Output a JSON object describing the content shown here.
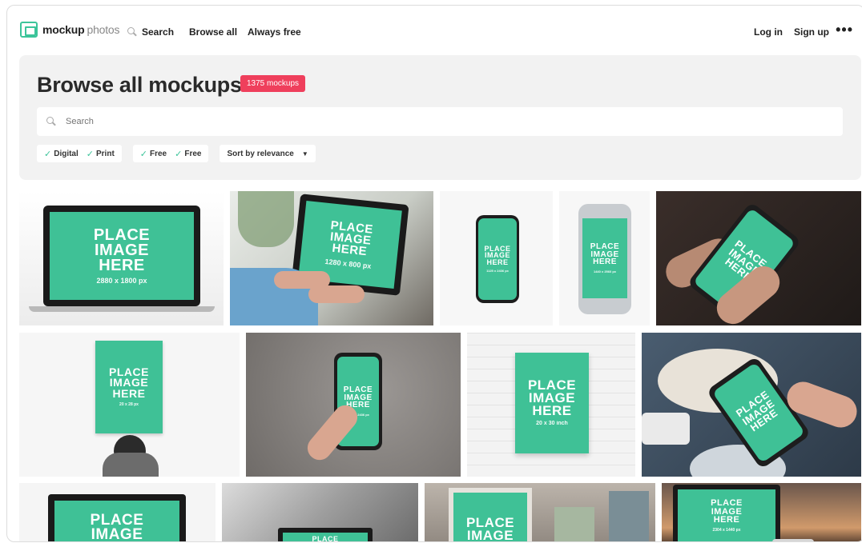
{
  "nav": {
    "logo_strong": "mockup",
    "logo_light": "photos",
    "search_label": "Search",
    "browse_all": "Browse all",
    "always_free": "Always free",
    "log_in": "Log in",
    "sign_up": "Sign up",
    "more": "•••"
  },
  "header": {
    "title": "Browse all mockups",
    "count_badge": "1375 mockups",
    "search_placeholder": "Search"
  },
  "filters": {
    "group1": [
      "Digital",
      "Print"
    ],
    "group2": [
      "Free",
      "Free"
    ],
    "sort_label": "Sort by relevance"
  },
  "colors": {
    "accent": "#3fc196",
    "badge": "#ef3f5c",
    "panel_bg": "#f2f2f2"
  },
  "mockups": {
    "placeholder_lines": [
      "PLACE",
      "IMAGE",
      "HERE"
    ],
    "row1": [
      {
        "dim": "2880 x 1800 px"
      },
      {
        "dim": "1280 x 800 px"
      },
      {
        "dim": "1125 x 2436 px"
      },
      {
        "dim": "1440 x 2560 px"
      },
      {
        "dim": ""
      }
    ],
    "row2": [
      {
        "dim": "20 x 28 px"
      },
      {
        "dim": "1125 x 2436 px"
      },
      {
        "dim": "20 x 30 inch"
      },
      {
        "dim": ""
      }
    ],
    "row3": [
      {
        "dim": ""
      },
      {
        "dim": ""
      },
      {
        "dim": ""
      },
      {
        "dim": "2304 x 1440 px"
      }
    ]
  }
}
